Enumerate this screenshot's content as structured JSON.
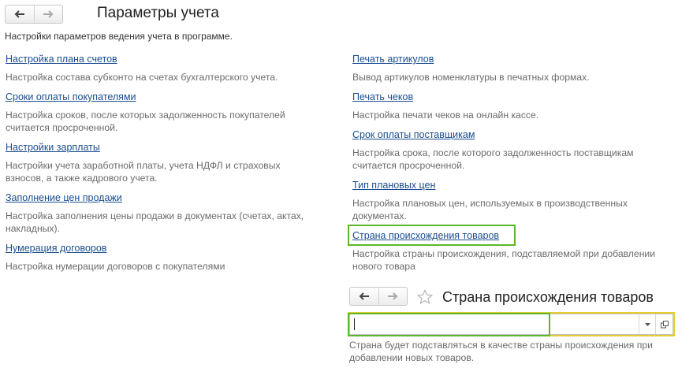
{
  "main": {
    "title": "Параметры учета",
    "subtitle": "Настройки параметров ведения учета в программе."
  },
  "left_items": [
    {
      "link": "Настройка плана счетов",
      "desc": "Настройка состава субконто на счетах бухгалтерского учета."
    },
    {
      "link": "Сроки оплаты покупателями",
      "desc": "Настройка сроков, после которых задолженность покупателей считается просроченной."
    },
    {
      "link": "Настройки зарплаты",
      "desc": "Настройки учета заработной платы, учета НДФЛ и страховых взносов, а также кадрового учета."
    },
    {
      "link": "Заполнение цен продажи",
      "desc": "Настройка заполнения цены продажи в документах (счетах, актах, накладных)."
    },
    {
      "link": "Нумерация договоров",
      "desc": "Настройка нумерации договоров с покупателями"
    }
  ],
  "right_items": [
    {
      "link": "Печать артикулов",
      "desc": "Вывод артикулов номенклатуры в печатных формах."
    },
    {
      "link": "Печать чеков",
      "desc": "Настройка печати чеков на онлайн кассе."
    },
    {
      "link": "Срок оплаты поставщикам",
      "desc": "Настройка срока, после которого задолженность поставщикам считается просроченной."
    },
    {
      "link": "Тип плановых цен",
      "desc": "Настройка плановых цен, используемых в производственных документах."
    },
    {
      "link": "Страна происхождения товаров",
      "desc": "Настройка страны происхождения, подставляемой при добавлении нового товара"
    }
  ],
  "country_form": {
    "title": "Страна происхождения товаров",
    "value": "",
    "hint": "Страна будет подставляться в качестве страны происхождения при добавлении новых товаров."
  },
  "icons": {
    "back": "arrow-left-icon",
    "forward": "arrow-right-icon",
    "favorite": "star-icon",
    "dropdown": "dropdown-arrow-icon",
    "open": "open-window-icon"
  },
  "colors": {
    "link": "#1a4d8f",
    "highlight_green": "#5cb82a",
    "highlight_yellow": "#e6cd2e",
    "description": "#6b6b6b"
  }
}
